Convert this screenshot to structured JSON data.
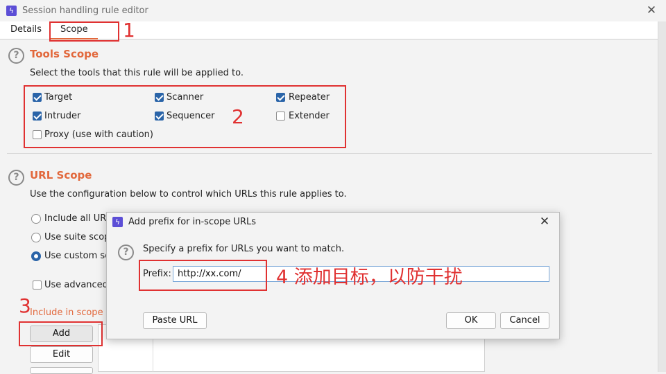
{
  "window": {
    "title": "Session handling rule editor",
    "close_glyph": "✕"
  },
  "tabs": [
    {
      "label": "Details"
    },
    {
      "label": "Scope"
    }
  ],
  "tools_scope": {
    "title": "Tools Scope",
    "description": "Select the tools that this rule will be applied to.",
    "tools": [
      {
        "label": "Target",
        "checked": true
      },
      {
        "label": "Scanner",
        "checked": true
      },
      {
        "label": "Repeater",
        "checked": true
      },
      {
        "label": "Intruder",
        "checked": true
      },
      {
        "label": "Sequencer",
        "checked": true
      },
      {
        "label": "Extender",
        "checked": false
      },
      {
        "label": "Proxy (use with caution)",
        "checked": false
      }
    ]
  },
  "url_scope": {
    "title": "URL Scope",
    "description": "Use the configuration below to control which URLs this rule applies to.",
    "options": [
      {
        "label": "Include all URL",
        "selected": false
      },
      {
        "label": "Use suite scop",
        "selected": false
      },
      {
        "label": "Use custom sc",
        "selected": true
      }
    ],
    "advanced_label": "Use advanced",
    "advanced_checked": false,
    "include_label": "Include in scope",
    "buttons": {
      "add": "Add",
      "edit": "Edit"
    }
  },
  "dialog": {
    "title": "Add prefix for in-scope URLs",
    "close_glyph": "✕",
    "prompt": "Specify a prefix for URLs you want to match.",
    "prefix_label": "Prefix:",
    "prefix_value": "http://xx.com/",
    "paste_button": "Paste URL",
    "ok_button": "OK",
    "cancel_button": "Cancel"
  },
  "annotations": {
    "n1": "1",
    "n2": "2",
    "n3": "3",
    "n4_text": "4 添加目标，以防干扰"
  },
  "icons": {
    "app": "burp-lightning-icon",
    "help": "question-icon"
  },
  "colors": {
    "accent": "#e2683c",
    "annotation": "#e03131",
    "check": "#2a64a8",
    "app_icon": "#5c4ed6"
  }
}
